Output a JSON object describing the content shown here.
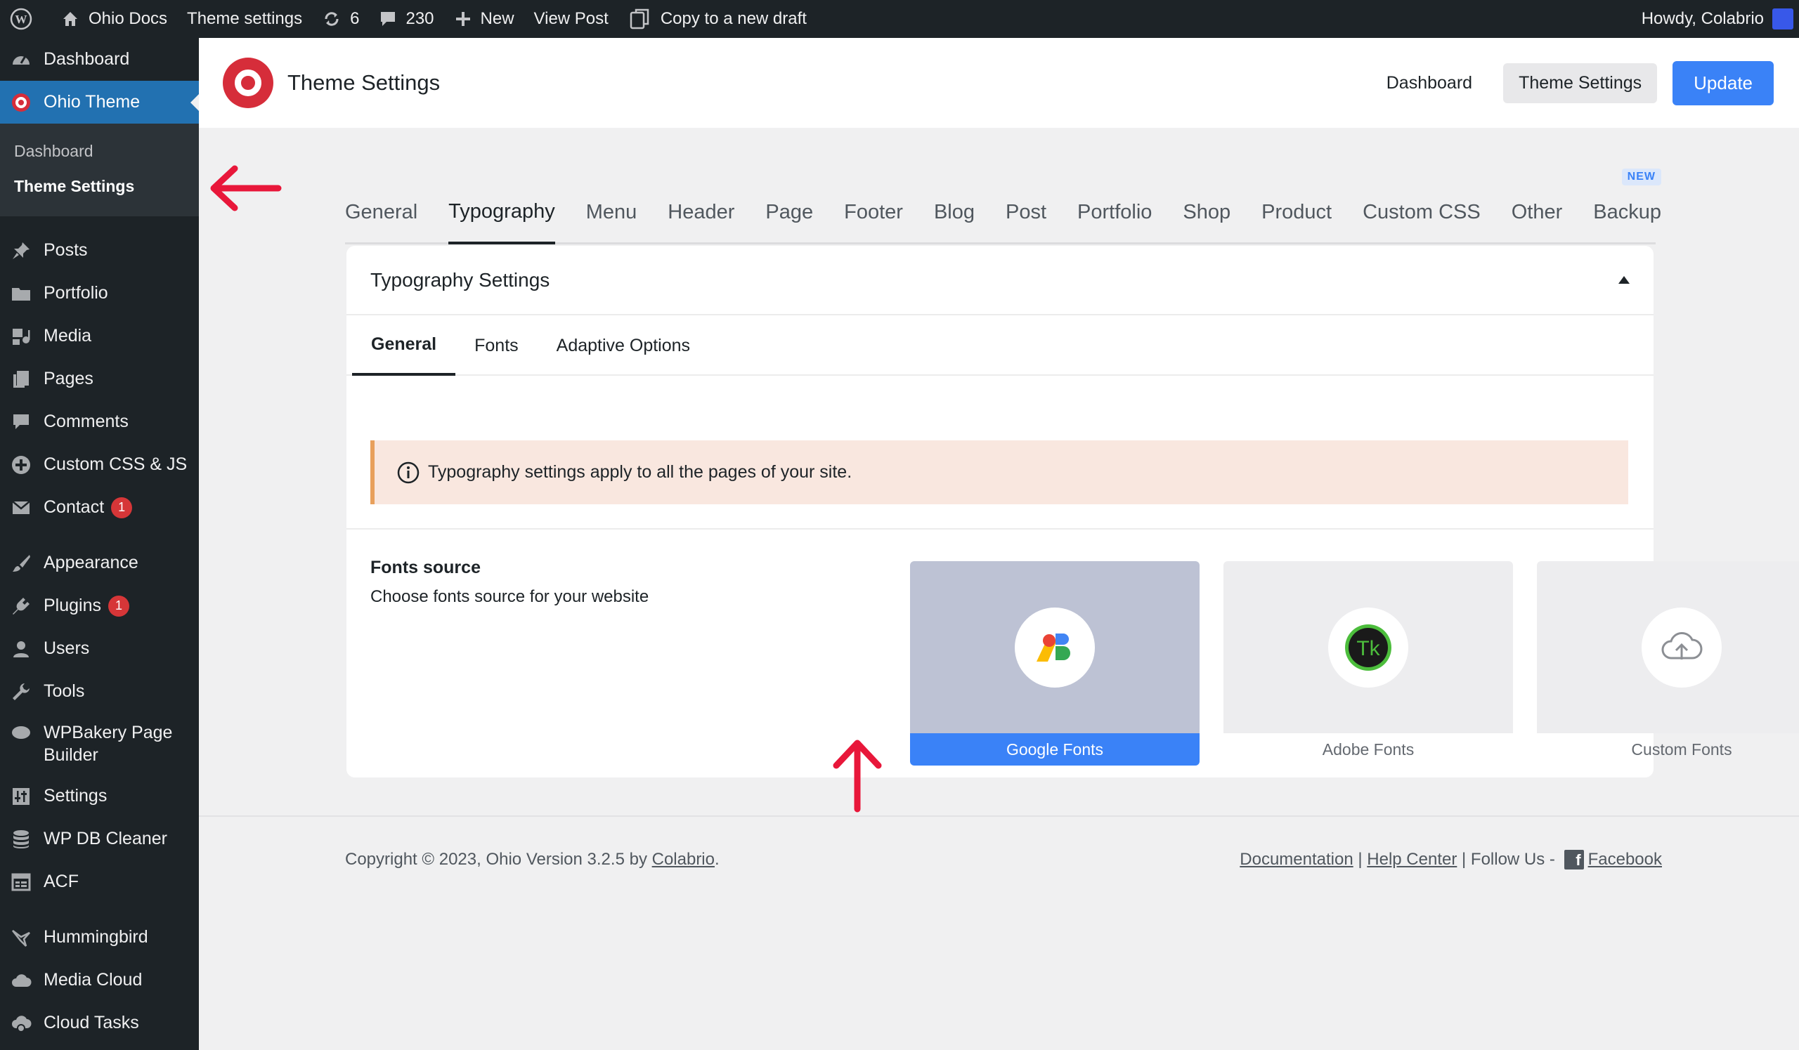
{
  "admin_bar": {
    "site_name": "Ohio Docs",
    "page_label": "Theme settings",
    "updates_count": "6",
    "comments_count": "230",
    "new_label": "New",
    "view_post_label": "View Post",
    "copy_draft_label": "Copy to a new draft",
    "greeting": "Howdy, Colabrio"
  },
  "sidebar": {
    "dashboard": "Dashboard",
    "ohio_theme": "Ohio Theme",
    "submenu": {
      "dashboard": "Dashboard",
      "theme_settings": "Theme Settings"
    },
    "posts": "Posts",
    "portfolio": "Portfolio",
    "media": "Media",
    "pages": "Pages",
    "comments": "Comments",
    "custom_css_js": "Custom CSS & JS",
    "contact": "Contact",
    "contact_badge": "1",
    "appearance": "Appearance",
    "plugins": "Plugins",
    "plugins_badge": "1",
    "users": "Users",
    "tools": "Tools",
    "wpbakery_line1": "WPBakery Page",
    "wpbakery_line2": "Builder",
    "settings": "Settings",
    "wp_db_cleaner": "WP DB Cleaner",
    "acf": "ACF",
    "hummingbird": "Hummingbird",
    "media_cloud": "Media Cloud",
    "cloud_tasks": "Cloud Tasks"
  },
  "header": {
    "title": "Theme Settings",
    "dashboard_btn": "Dashboard",
    "theme_settings_btn": "Theme Settings",
    "update_btn": "Update"
  },
  "tabs": {
    "general": "General",
    "typography": "Typography",
    "menu": "Menu",
    "header": "Header",
    "page": "Page",
    "footer": "Footer",
    "blog": "Blog",
    "post": "Post",
    "portfolio": "Portfolio",
    "shop": "Shop",
    "product": "Product",
    "custom_css": "Custom CSS",
    "other": "Other",
    "backup": "Backup",
    "backup_badge": "NEW"
  },
  "panel": {
    "title": "Typography Settings",
    "subtabs": {
      "general": "General",
      "fonts": "Fonts",
      "adaptive": "Adaptive Options"
    },
    "notice": "Typography settings apply to all the pages of your site.",
    "fonts_source": {
      "title": "Fonts source",
      "description": "Choose fonts source for your website",
      "options": {
        "google": "Google Fonts",
        "adobe": "Adobe Fonts",
        "custom": "Custom Fonts"
      },
      "adobe_icon_text": "Tk"
    }
  },
  "footer": {
    "copyright": "Copyright © 2023, Ohio Version 3.2.5 by ",
    "author_link": "Colabrio",
    "period": ".",
    "documentation": "Documentation",
    "sep1": " | ",
    "help_center": "Help Center",
    "follow": " | Follow Us - ",
    "facebook": "Facebook"
  },
  "colors": {
    "accent": "#3a82f7",
    "wp_admin_dark": "#1d2327",
    "brand_red": "#d62d3a",
    "annotation_red": "#e8173a"
  }
}
